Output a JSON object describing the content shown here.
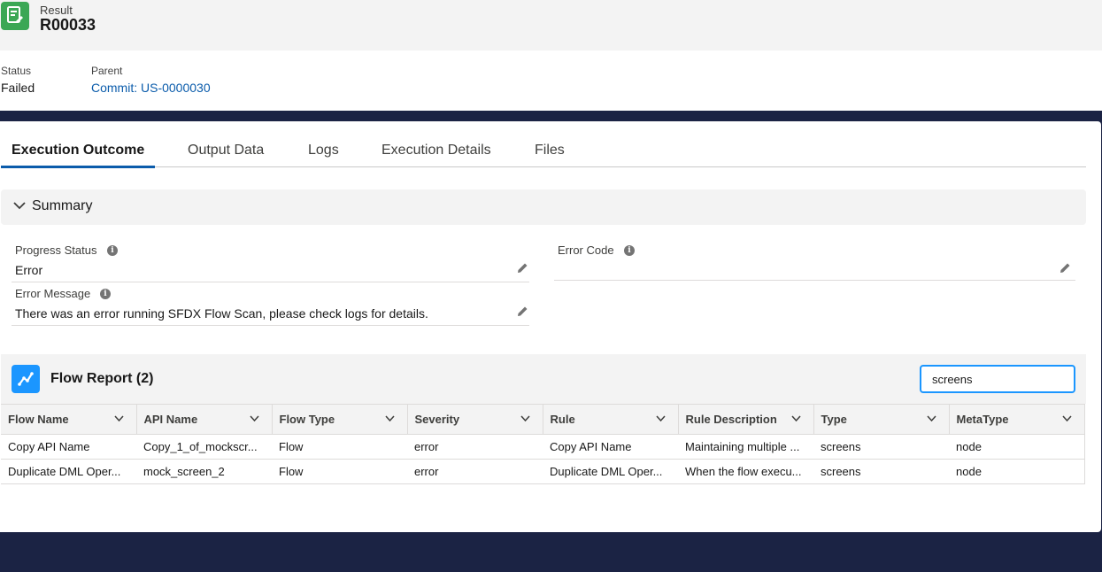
{
  "header": {
    "object_type": "Result",
    "record_name": "R00033",
    "icon": "record-icon"
  },
  "highlights": {
    "status_label": "Status",
    "status_value": "Failed",
    "parent_label": "Parent",
    "parent_value": "Commit: US-0000030"
  },
  "tabs": [
    {
      "label": "Execution Outcome",
      "active": true
    },
    {
      "label": "Output Data"
    },
    {
      "label": "Logs"
    },
    {
      "label": "Execution Details"
    },
    {
      "label": "Files"
    }
  ],
  "summary": {
    "title": "Summary",
    "fields": {
      "progress_status": {
        "label": "Progress Status",
        "value": "Error"
      },
      "error_code": {
        "label": "Error Code",
        "value": ""
      },
      "error_message": {
        "label": "Error Message",
        "value": "There was an error running SFDX Flow Scan, please check logs for details."
      }
    }
  },
  "flow_report": {
    "title": "Flow Report (2)",
    "search_value": "screens",
    "columns": [
      "Flow Name",
      "API Name",
      "Flow Type",
      "Severity",
      "Rule",
      "Rule Description",
      "Type",
      "MetaType"
    ],
    "rows": [
      [
        "Copy API Name",
        "Copy_1_of_mockscr...",
        "Flow",
        "error",
        "Copy API Name",
        "Maintaining multiple ...",
        "screens",
        "node"
      ],
      [
        "Duplicate DML Oper...",
        "mock_screen_2",
        "Flow",
        "error",
        "Duplicate DML Oper...",
        "When the flow execu...",
        "screens",
        "node"
      ]
    ]
  },
  "colors": {
    "accent": "#0b5cab",
    "record_icon": "#3ba755",
    "report_icon": "#1b96ff",
    "backdrop": "#1b2344"
  }
}
